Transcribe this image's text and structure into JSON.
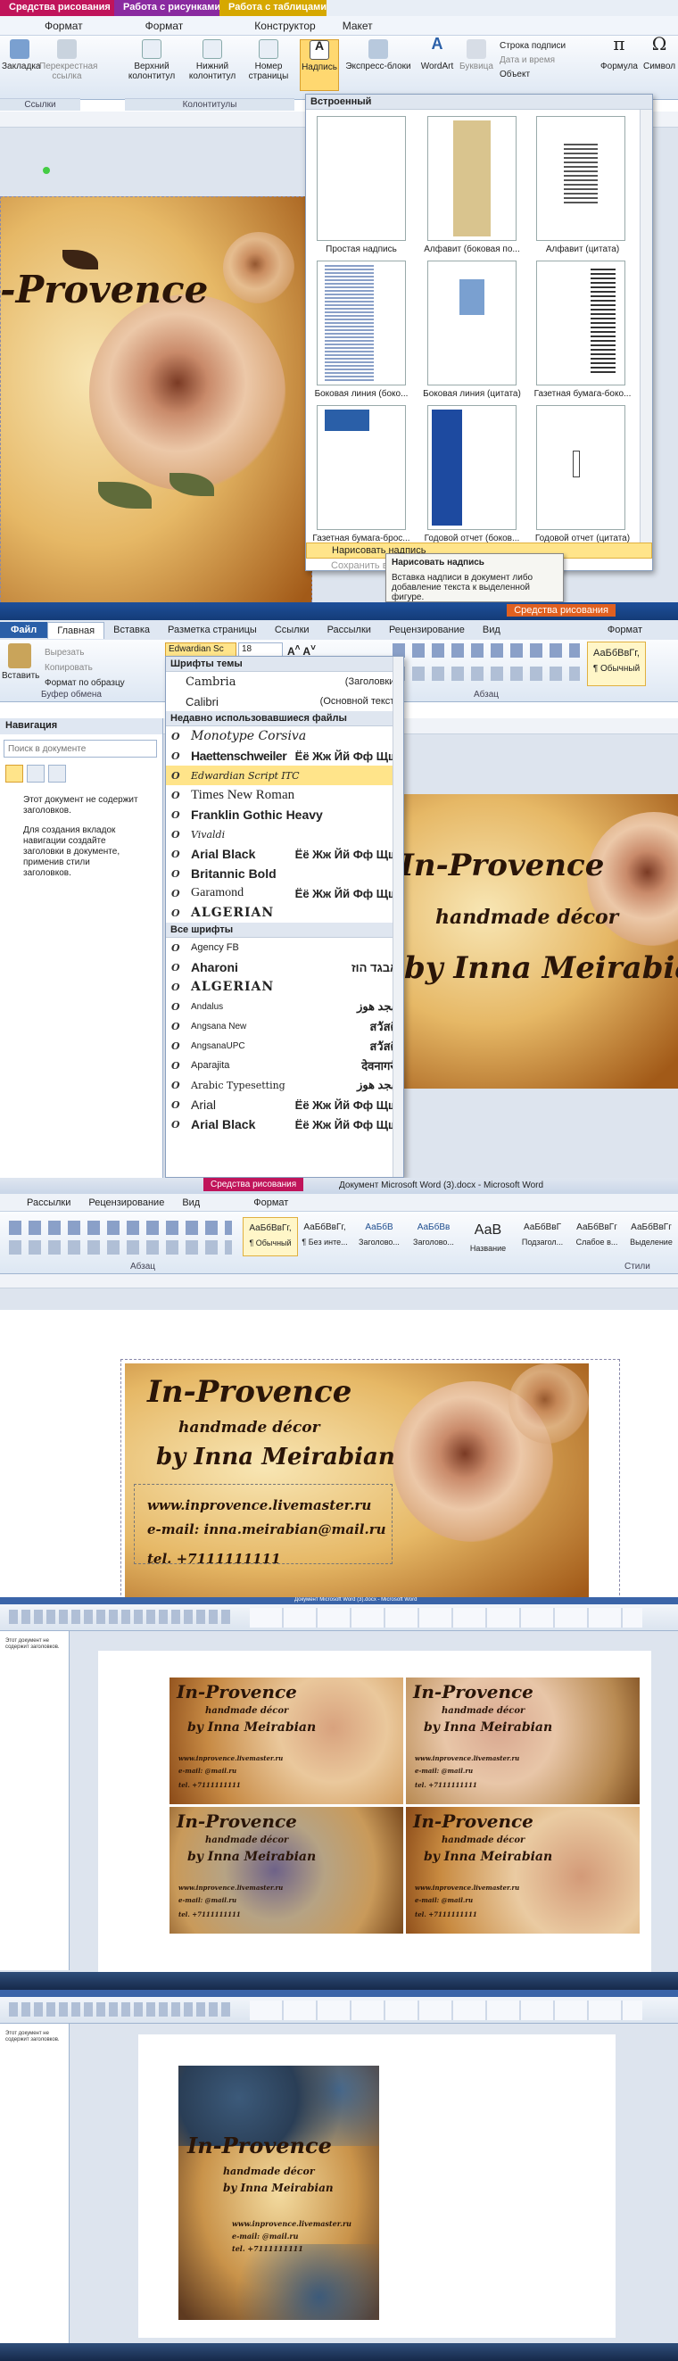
{
  "p1": {
    "context_tabs": [
      {
        "label": "Средства рисования",
        "color": "#c0145a"
      },
      {
        "label": "Работа с рисунками",
        "color": "#8a2aa0"
      },
      {
        "label": "Работа с таблицами",
        "color": "#d6a800"
      }
    ],
    "sub_tabs": [
      "Формат",
      "Формат",
      "Конструктор",
      "Макет"
    ],
    "ribbon_buttons": [
      "Закладка",
      "Перекрестная ссылка",
      "Верхний колонтитул",
      "Нижний колонтитул",
      "Номер страницы",
      "Надпись",
      "Экспресс-блоки",
      "WordArt",
      "Буквица",
      "Формула",
      "Символ"
    ],
    "right_options": [
      "Строка подписи",
      "Дата и время",
      "Объект"
    ],
    "group_labels": [
      "Ссылки",
      "Колонтитулы"
    ],
    "gallery": {
      "header": "Встроенный",
      "items": [
        "Простая надпись",
        "Алфавит (боковая по...",
        "Алфавит (цитата)",
        "Боковая линия (боко...",
        "Боковая линия (цитата)",
        "Газетная бумага-боко...",
        "Газетная бумага-брос...",
        "Годовой отчет (боков...",
        "Годовой отчет (цитата)"
      ],
      "draw": "Нарисовать надпись",
      "save": "Сохранить вы..."
    },
    "tooltip": {
      "title": "Нарисовать надпись",
      "body": "Вставка надписи в документ либо добавление текста к выделенной фигуре."
    },
    "card_text": "In-Provence"
  },
  "p2": {
    "context_tab": "Средства рисования",
    "tabs": [
      "Файл",
      "Главная",
      "Вставка",
      "Разметка страницы",
      "Ссылки",
      "Рассылки",
      "Рецензирование",
      "Вид",
      "Формат"
    ],
    "clipboard": {
      "paste": "Вставить",
      "cut": "Вырезать",
      "copy": "Копировать",
      "format": "Формат по образцу",
      "group": "Буфер обмена"
    },
    "font_name": "Edwardian Sc",
    "font_size": "18",
    "paragraph_group": "Абзац",
    "style_sample": "АаБбВвГг,",
    "style_name": "¶ Обычный",
    "nav": {
      "title": "Навигация",
      "search_placeholder": "Поиск в документе",
      "message": "Этот документ не содержит заголовков.",
      "help": "Для создания вкладок навигации создайте заголовки в документе, применив стили заголовков."
    },
    "font_sections": {
      "theme": "Шрифты темы",
      "recent": "Недавно использовавшиеся файлы",
      "all": "Все шрифты"
    },
    "theme_fonts": [
      {
        "name": "Cambria",
        "tag": "(Заголовки)"
      },
      {
        "name": "Calibri",
        "tag": "(Основной текст)"
      }
    ],
    "recent_fonts": [
      {
        "name": "Monotype Corsiva",
        "sample": ""
      },
      {
        "name": "Haettenschweiler",
        "sample": "Ёё Жж Йй Фф Щщ"
      },
      {
        "name": "Edwardian Script ITC",
        "sample": ""
      },
      {
        "name": "Times New Roman",
        "sample": ""
      },
      {
        "name": "Franklin Gothic Heavy",
        "sample": ""
      },
      {
        "name": "Vivaldi",
        "sample": ""
      },
      {
        "name": "Arial Black",
        "sample": "Ёё Жж Йй Фф Щщ"
      },
      {
        "name": "Britannic Bold",
        "sample": ""
      },
      {
        "name": "Garamond",
        "sample": "Ёё Жж Йй Фф Щщ"
      },
      {
        "name": "ALGERIAN",
        "sample": ""
      }
    ],
    "all_fonts": [
      {
        "name": "Agency FB",
        "sample": ""
      },
      {
        "name": "Aharoni",
        "sample": "אבגד הוז"
      },
      {
        "name": "ALGERIAN",
        "sample": ""
      },
      {
        "name": "Andalus",
        "sample": "أبجد هوز"
      },
      {
        "name": "Angsana New",
        "sample": "สวัสดี"
      },
      {
        "name": "AngsanaUPC",
        "sample": "สวัสดี"
      },
      {
        "name": "Aparajita",
        "sample": "देवनागरी"
      },
      {
        "name": "Arabic Typesetting",
        "sample": "أبجد هوز"
      },
      {
        "name": "Arial",
        "sample": "Ёё Жж Йй Фф Щщ"
      },
      {
        "name": "Arial Black",
        "sample": "Ёё Жж Йй Фф Щщ"
      }
    ],
    "card_lines": [
      "In-Provence",
      "handmade décor",
      "by Inna Meirabian"
    ]
  },
  "p3": {
    "context_tab": "Средства рисования",
    "window_title": "Документ Microsoft Word (3).docx - Microsoft Word",
    "tabs": [
      "Рассылки",
      "Рецензирование",
      "Вид",
      "Формат"
    ],
    "styles": [
      {
        "sample": "АаБбВвГг,",
        "name": "¶ Обычный"
      },
      {
        "sample": "АаБбВвГг,",
        "name": "¶ Без инте..."
      },
      {
        "sample": "АаБбВ",
        "name": "Заголово..."
      },
      {
        "sample": "АаБбВв",
        "name": "Заголово..."
      },
      {
        "sample": "АаВ",
        "name": "Название"
      },
      {
        "sample": "АаБбВвГ",
        "name": "Подзагол..."
      },
      {
        "sample": "АаБбВвГг",
        "name": "Слабое в..."
      },
      {
        "sample": "АаБбВвГг",
        "name": "Выделение"
      }
    ],
    "group_labels": [
      "Абзац",
      "Стили"
    ],
    "card": {
      "title": "In-Provence",
      "subtitle": "handmade décor",
      "author": "by Inna Meirabian",
      "site": "www.inprovence.livemaster.ru",
      "email": "e-mail: inna.meirabian@mail.ru",
      "phone": "tel. +7111111111"
    }
  },
  "p4": {
    "window_title": "Документ Microsoft Word (3).docx - Microsoft Word",
    "cards": [
      {
        "title": "In-Provence",
        "subtitle": "handmade décor",
        "author": "by Inna Meirabian",
        "site": "www.inprovence.livemaster.ru",
        "email": "e-mail:          @mail.ru",
        "phone": "tel. +7111111111"
      },
      {
        "title": "In-Provence",
        "subtitle": "handmade décor",
        "author": "by Inna Meirabian",
        "site": "www.inprovence.livemaster.ru",
        "email": "e-mail:          @mail.ru",
        "phone": "tel. +7111111111"
      },
      {
        "title": "In-Provence",
        "subtitle": "handmade décor",
        "author": "by Inna Meirabian",
        "site": "www.inprovence.livemaster.ru",
        "email": "e-mail:          @mail.ru",
        "phone": "tel. +7111111111"
      },
      {
        "title": "In-Provence",
        "subtitle": "handmade décor",
        "author": "by Inna Meirabian",
        "site": "www.inprovence.livemaster.ru",
        "email": "e-mail:          @mail.ru",
        "phone": "tel. +7111111111"
      }
    ],
    "nav_text": "Этот документ не содержит заголовков."
  },
  "p5": {
    "card": {
      "title": "In-Provence",
      "subtitle": "handmade décor",
      "author": "by Inna Meirabian",
      "site": "www.inprovence.livemaster.ru",
      "email": "e-mail:          @mail.ru",
      "phone": "tel. +7111111111"
    },
    "nav_text": "Этот документ не содержит заголовков."
  }
}
